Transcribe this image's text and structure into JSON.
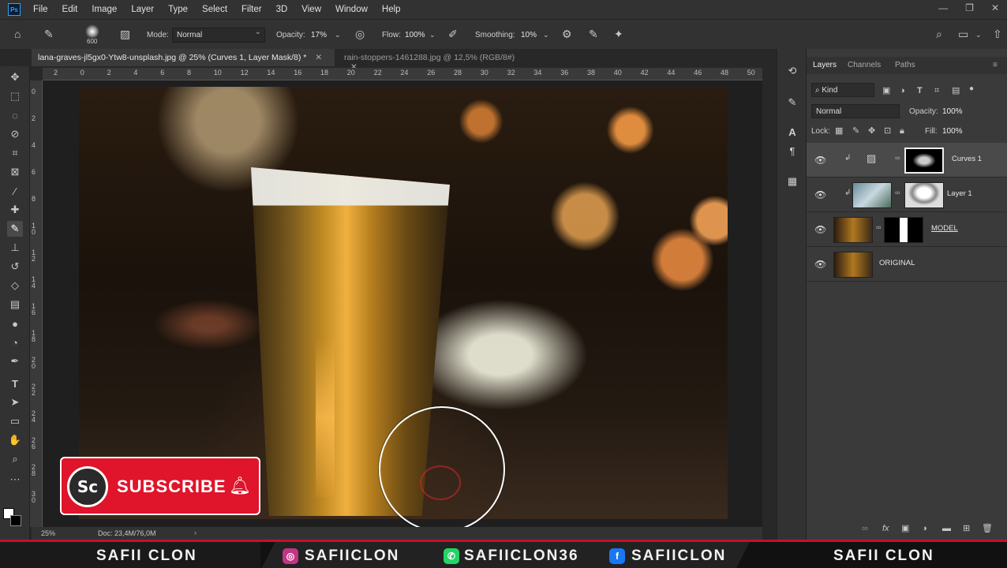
{
  "menubar": {
    "logo": "Ps",
    "items": [
      "File",
      "Edit",
      "Image",
      "Layer",
      "Type",
      "Select",
      "Filter",
      "3D",
      "View",
      "Window",
      "Help"
    ]
  },
  "options": {
    "brush_size": "600",
    "mode_label": "Mode:",
    "mode_value": "Normal",
    "opacity_label": "Opacity:",
    "opacity_value": "17%",
    "flow_label": "Flow:",
    "flow_value": "100%",
    "smoothing_label": "Smoothing:",
    "smoothing_value": "10%"
  },
  "tabs": [
    {
      "label": "lana-graves-jl5gx0-Ytw8-unsplash.jpg @ 25% (Curves 1, Layer Mask/8) *"
    },
    {
      "label": "rain-stoppers-1461288.jpg @ 12,5% (RGB/8#)"
    }
  ],
  "ruler_top": [
    "2",
    "0",
    "2",
    "4",
    "6",
    "8",
    "10",
    "12",
    "14",
    "16",
    "18",
    "20",
    "22",
    "24",
    "26",
    "28",
    "30",
    "32",
    "34",
    "36",
    "38",
    "40",
    "42",
    "44",
    "46",
    "48",
    "50"
  ],
  "ruler_left": [
    "0",
    "2",
    "4",
    "6",
    "8",
    "1\n0",
    "1\n2",
    "1\n4",
    "1\n6",
    "1\n8",
    "2\n0",
    "2\n2",
    "2\n4",
    "2\n6",
    "2\n8",
    "3\n0"
  ],
  "status": {
    "zoom": "25%",
    "doc": "Doc: 23,4M/76,0M"
  },
  "layers_panel": {
    "tabs": [
      "Layers",
      "Channels",
      "Paths"
    ],
    "filter_kind": "Kind",
    "blend_mode": "Normal",
    "opacity_label": "Opacity:",
    "opacity_value": "100%",
    "lock_label": "Lock:",
    "fill_label": "Fill:",
    "fill_value": "100%",
    "layers": [
      {
        "name": "Curves 1"
      },
      {
        "name": "Layer 1"
      },
      {
        "name": "MODEL"
      },
      {
        "name": "ORIGINAL"
      }
    ]
  },
  "overlay": {
    "subscribe_logo": "Sc",
    "subscribe_label": "SUBSCRIBE"
  },
  "banner": {
    "left_text": "SAFII CLON",
    "instagram": "SAFIICLON",
    "whatsapp": "SAFIICLON36",
    "facebook": "SAFIICLON",
    "right_text": "SAFII CLON"
  }
}
